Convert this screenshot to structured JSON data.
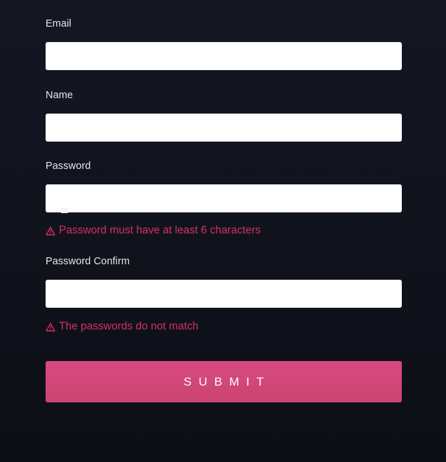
{
  "form": {
    "email": {
      "label": "Email",
      "value": "",
      "placeholder": ""
    },
    "name": {
      "label": "Name",
      "value": "",
      "placeholder": ""
    },
    "password": {
      "label": "Password",
      "value": "",
      "placeholder": "",
      "error": "Password must have at least 6 characters"
    },
    "password_confirm": {
      "label": "Password Confirm",
      "value": "",
      "placeholder": "",
      "error": "The passwords do not match"
    },
    "submit_label": "SUBMIT"
  },
  "icons": {
    "error_icon": "warning-triangle-icon"
  },
  "colors": {
    "background": "#10131c",
    "error": "#d6305f",
    "button": "#d0477a",
    "label": "#e6e7ec"
  }
}
